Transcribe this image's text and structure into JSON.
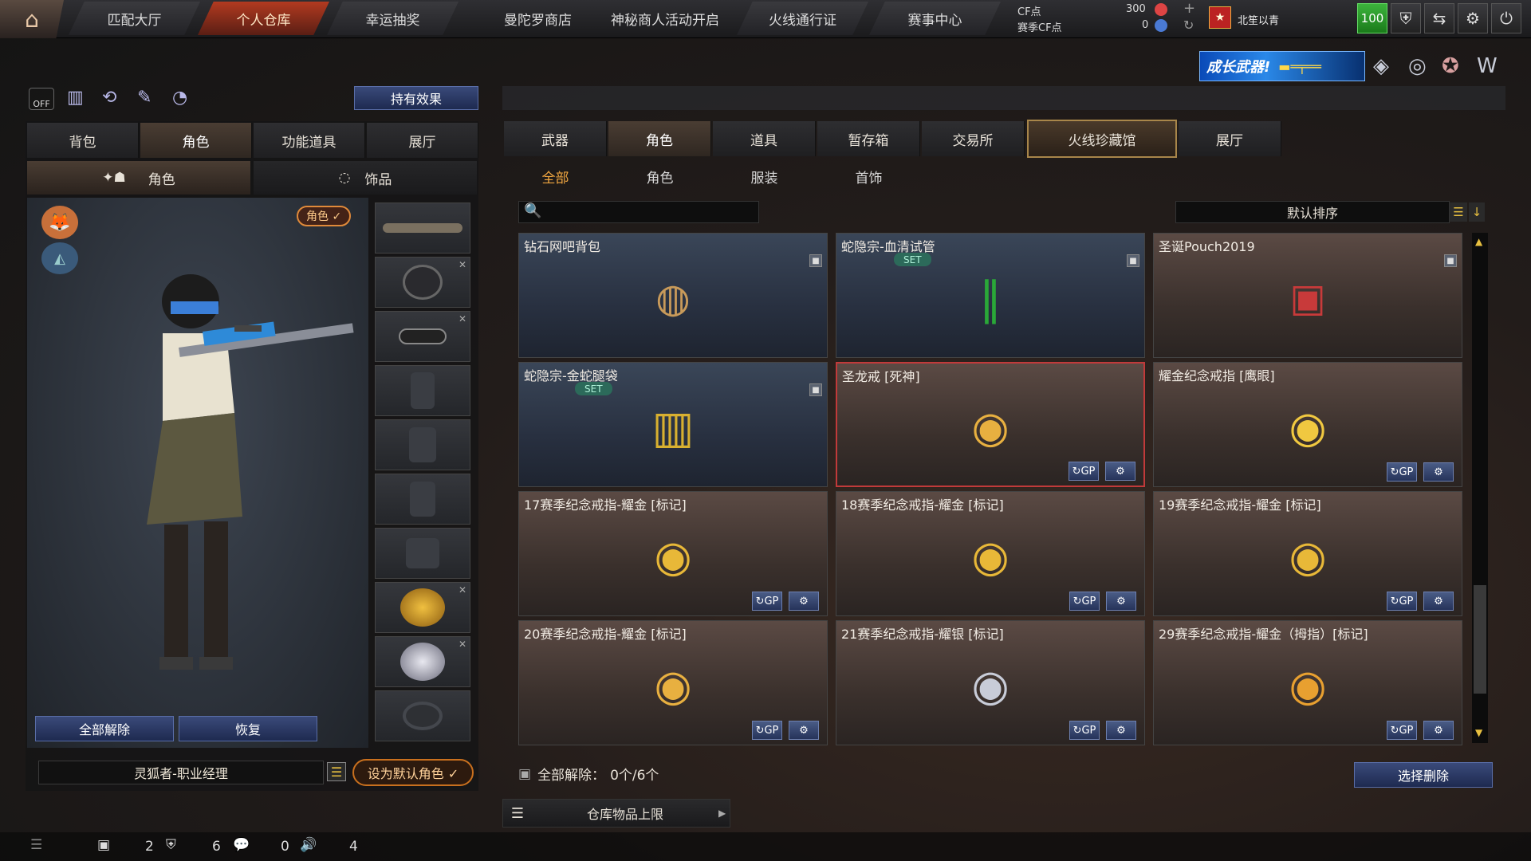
{
  "nav": {
    "tabs": [
      "匹配大厅",
      "个人仓库",
      "幸运抽奖",
      "曼陀罗商店",
      "神秘商人活动开启",
      "火线通行证",
      "赛事中心"
    ],
    "active_index": 1
  },
  "currency": {
    "cf_label": "CF点",
    "cf_value": "300",
    "match_label": "赛季CF点",
    "match_value": "0"
  },
  "user": {
    "name": "北笙以青",
    "level": "100"
  },
  "banner": {
    "text": "成长武器!"
  },
  "left": {
    "effect_button": "持有效果",
    "tabs": [
      "背包",
      "角色",
      "功能道具",
      "展厅"
    ],
    "active_tab": 1,
    "subtabs": [
      "角色",
      "饰品"
    ],
    "role_badge": "角色 ✓",
    "unequip_all": "全部解除",
    "restore": "恢复",
    "character_name": "灵狐者-职业经理",
    "set_default": "设为默认角色 ✓"
  },
  "right": {
    "tabs": [
      "武器",
      "角色",
      "道具",
      "暂存箱",
      "交易所",
      "火线珍藏馆",
      "展厅"
    ],
    "active_tab": 1,
    "highlight_tab": 5,
    "subtabs": [
      "全部",
      "角色",
      "服装",
      "首饰"
    ],
    "active_subtab": 0,
    "search_placeholder": "",
    "sort": "默认排序",
    "items": [
      {
        "name": "钻石网吧背包",
        "theme": "blue",
        "lock": true,
        "set": false,
        "actions": false,
        "icon": "backpack-icon"
      },
      {
        "name": "蛇隐宗-血清试管",
        "theme": "blue",
        "lock": true,
        "set": true,
        "actions": false,
        "icon": "test-tube-icon"
      },
      {
        "name": "圣诞Pouch2019",
        "theme": "brown",
        "lock": true,
        "set": false,
        "actions": false,
        "icon": "pouch-icon"
      },
      {
        "name": "蛇隐宗-金蛇腿袋",
        "theme": "blue",
        "lock": true,
        "set": true,
        "actions": false,
        "icon": "leg-bag-icon"
      },
      {
        "name": "圣龙戒 [死神]",
        "theme": "brown",
        "lock": false,
        "set": false,
        "actions": true,
        "selected": true,
        "icon": "dragon-ring-icon"
      },
      {
        "name": "耀金纪念戒指 [鹰眼]",
        "theme": "brown",
        "lock": false,
        "set": false,
        "actions": true,
        "icon": "gold-ring-icon"
      },
      {
        "name": "17赛季纪念戒指-耀金 [标记]",
        "theme": "brown",
        "lock": false,
        "set": false,
        "actions": true,
        "icon": "season-ring-icon"
      },
      {
        "name": "18赛季纪念戒指-耀金 [标记]",
        "theme": "brown",
        "lock": false,
        "set": false,
        "actions": true,
        "icon": "season-ring-icon"
      },
      {
        "name": "19赛季纪念戒指-耀金 [标记]",
        "theme": "brown",
        "lock": false,
        "set": false,
        "actions": true,
        "icon": "season-ring-icon"
      },
      {
        "name": "20赛季纪念戒指-耀金 [标记]",
        "theme": "brown",
        "lock": false,
        "set": false,
        "actions": true,
        "icon": "dragon-ring-icon"
      },
      {
        "name": "21赛季纪念戒指-耀银 [标记]",
        "theme": "brown",
        "lock": false,
        "set": false,
        "actions": true,
        "icon": "tiger-ring-icon"
      },
      {
        "name": "29赛季纪念戒指-耀金（拇指）[标记]",
        "theme": "brown",
        "lock": false,
        "set": false,
        "actions": true,
        "icon": "thumb-ring-icon"
      }
    ],
    "set_label": "SET",
    "unequip_status": "全部解除：",
    "unequip_count": "0个/6个",
    "delete_select": "选择删除",
    "storage_limit": "仓库物品上限"
  },
  "status": {
    "v1": "2",
    "v2": "6",
    "v3": "0",
    "v4": "4"
  }
}
